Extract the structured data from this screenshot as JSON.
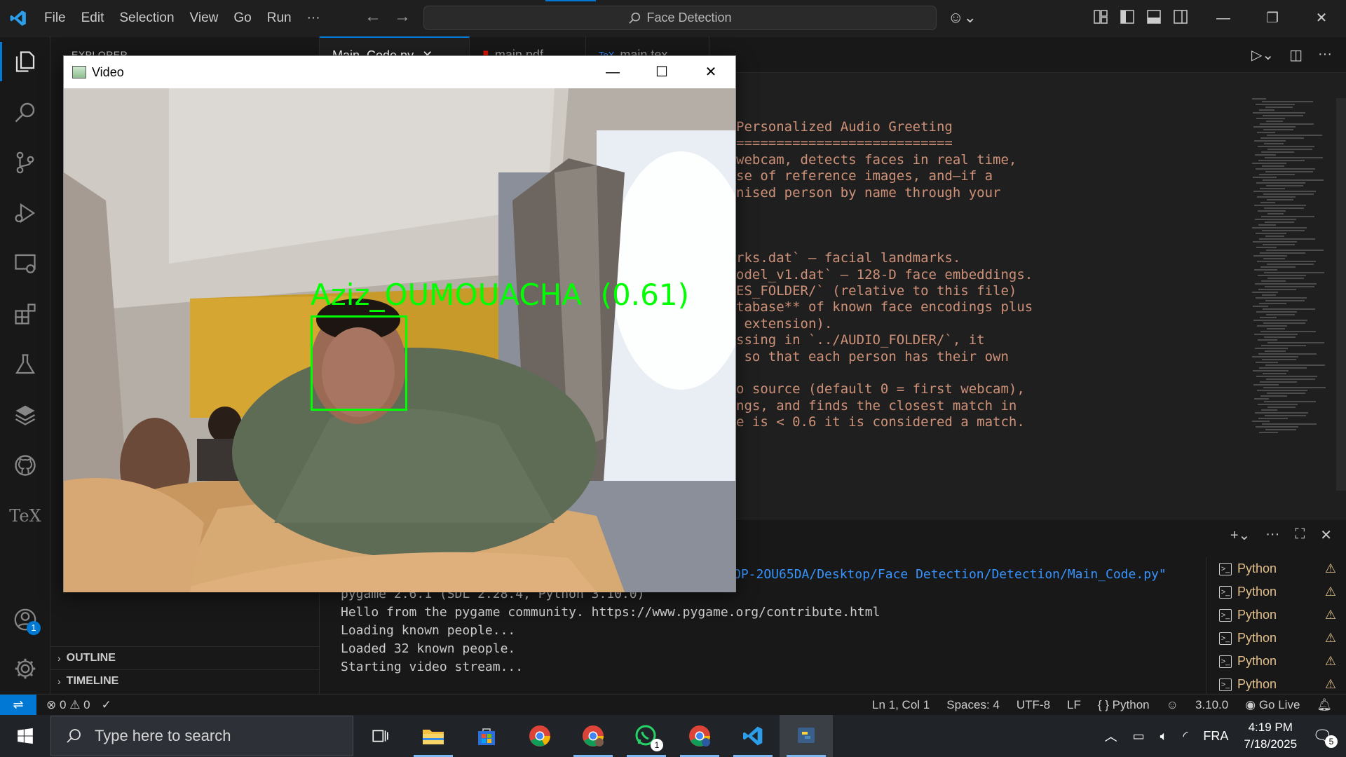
{
  "titlebar": {
    "menu": [
      "File",
      "Edit",
      "Selection",
      "View",
      "Go",
      "Run",
      "···"
    ],
    "search_text": "Face Detection"
  },
  "sidebar": {
    "header": "EXPLORER",
    "sections": [
      "OUTLINE",
      "TIMELINE"
    ]
  },
  "activity_badges": {
    "accounts": "1"
  },
  "tabs": [
    {
      "label": "Main_Code.py",
      "active": true
    },
    {
      "label": "main.pdf",
      "active": false
    },
    {
      "label": "main.tex",
      "active": false
    }
  ],
  "code_lines": [
    "Personalized Audio Greeting",
    "===========================",
    "webcam, detects faces in real time,",
    "se of reference images, and—if a",
    "nised person by name through your",
    "",
    "",
    "",
    "rks.dat` — facial landmarks.",
    "odel_v1.dat` — 128-D face embeddings.",
    "ES_FOLDER/` (relative to this file)",
    "tabase** of known face encodings plus",
    " extension).",
    "ssing in `../AUDIO_FOLDER/`, it",
    " so that each person has their own",
    "",
    "o source (default 0 = first webcam),",
    "ngs, and finds the closest match in",
    "e is < 0.6 it is considered a match."
  ],
  "terminal": {
    "path_line": "OP-2OU65DA/Desktop/Face Detection/Detection/Main_Code.py\"",
    "lines": [
      "pygame 2.6.1 (SDL 2.28.4, Python 3.10.0)",
      "Hello from the pygame community. https://www.pygame.org/contribute.html",
      "Loading known people...",
      "Loaded 32 known people.",
      "Starting video stream..."
    ],
    "list": [
      "Python",
      "Python",
      "Python",
      "Python",
      "Python",
      "Python"
    ]
  },
  "statusbar": {
    "errors": "0",
    "warnings": "0",
    "position": "Ln 1, Col 1",
    "spaces": "Spaces: 4",
    "encoding": "UTF-8",
    "eol": "LF",
    "language": "{ } Python",
    "version": "3.10.0",
    "golive": "Go Live"
  },
  "video_window": {
    "title": "Video",
    "detection_label": "Aziz_OUMOUACHA  (0.61)"
  },
  "taskbar": {
    "search_placeholder": "Type here to search",
    "lang": "FRA",
    "time": "4:19 PM",
    "date": "7/18/2025",
    "whatsapp_badge": "1",
    "notification_count": "5"
  }
}
